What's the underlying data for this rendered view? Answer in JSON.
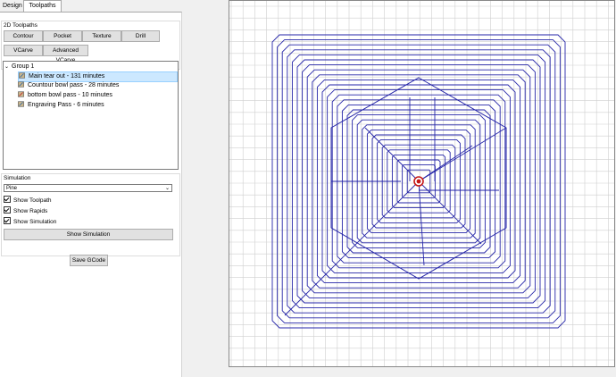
{
  "tabs": [
    {
      "label": "Design"
    },
    {
      "label": "Toolpaths"
    }
  ],
  "toolpaths_2d": {
    "title": "2D Toolpaths",
    "buttons": [
      "Contour",
      "Pocket",
      "Texture",
      "Drill",
      "VCarve",
      "Advanced VCarve"
    ]
  },
  "tree": {
    "group_label": "Group 1",
    "items": [
      {
        "label": "Main tear out - 131 minutes",
        "selected": true
      },
      {
        "label": "Countour bowl pass - 28 minutes",
        "selected": false
      },
      {
        "label": "bottom bowl pass - 10 minutes",
        "selected": false
      },
      {
        "label": "Engraving Pass - 6 minutes",
        "selected": false
      }
    ]
  },
  "simulation": {
    "title": "Simulation",
    "material": "Pine",
    "checkboxes": [
      {
        "label": "Show Toolpath",
        "checked": true
      },
      {
        "label": "Show Rapids",
        "checked": true
      },
      {
        "label": "Show Simulation",
        "checked": true
      }
    ],
    "show_button": "Show Simulation"
  },
  "save_gcode": "Save GCode",
  "colors": {
    "toolpath": "#2626a8",
    "grid": "#cfcfcf",
    "selection": "#cce8ff"
  }
}
